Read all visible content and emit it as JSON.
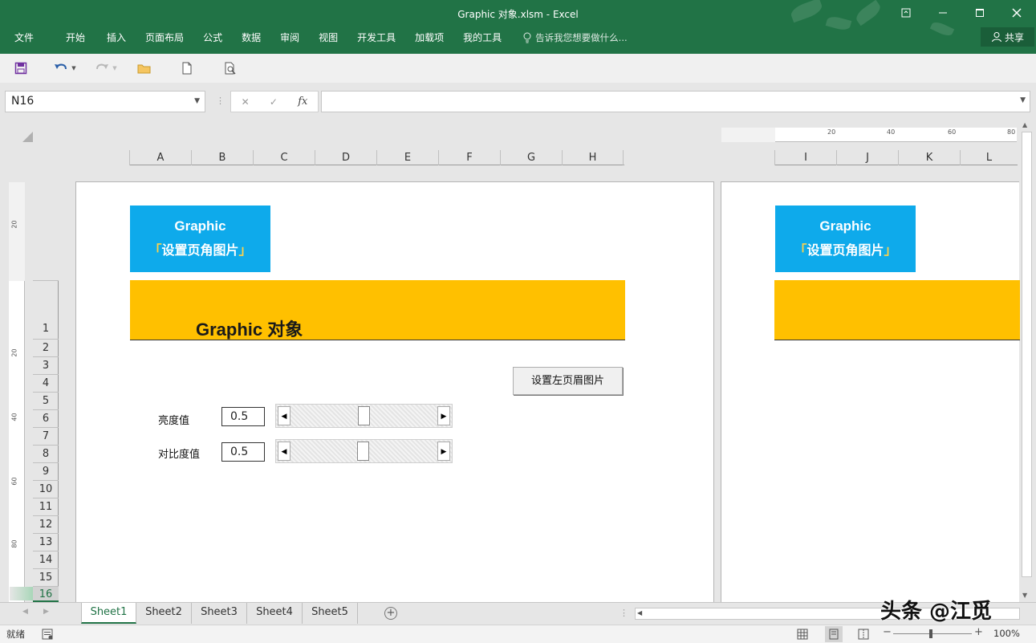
{
  "window": {
    "title": "Graphic 对象.xlsm - Excel"
  },
  "ribbon": {
    "tabs": [
      "文件",
      "开始",
      "插入",
      "页面布局",
      "公式",
      "数据",
      "审阅",
      "视图",
      "开发工具",
      "加载项",
      "我的工具"
    ],
    "tell_me": "告诉我您想要做什么...",
    "share": "共享"
  },
  "formula_bar": {
    "name_box": "N16",
    "fx": "fx",
    "formula": ""
  },
  "columns_left": [
    "A",
    "B",
    "C",
    "D",
    "E",
    "F",
    "G",
    "H"
  ],
  "columns_right": [
    "I",
    "J",
    "K",
    "L"
  ],
  "rows": [
    "1",
    "2",
    "3",
    "4",
    "5",
    "6",
    "7",
    "8",
    "9",
    "10",
    "11",
    "12",
    "13",
    "14",
    "15",
    "16"
  ],
  "selected_row": "16",
  "ruler": {
    "horizontal": [
      "20",
      "40",
      "60",
      "80"
    ],
    "vertical": [
      "20",
      "20",
      "40",
      "60",
      "80"
    ]
  },
  "page1": {
    "banner_line1": "Graphic",
    "banner_line2": "设置页角图片",
    "heading": "Graphic 对象",
    "button": "设置左页眉图片",
    "brightness_label": "亮度值",
    "brightness_value": "0.5",
    "contrast_label": "对比度值",
    "contrast_value": "0.5"
  },
  "page2": {
    "banner_line1": "Graphic",
    "banner_line2": "设置页角图片"
  },
  "sheets": [
    "Sheet1",
    "Sheet2",
    "Sheet3",
    "Sheet4",
    "Sheet5"
  ],
  "active_sheet": "Sheet1",
  "status": {
    "ready": "就绪",
    "zoom": "100%"
  },
  "watermark": "头条 @江觅",
  "colors": {
    "excel_green": "#217346",
    "banner_blue": "#0eaaeb",
    "gold": "#ffc000"
  }
}
